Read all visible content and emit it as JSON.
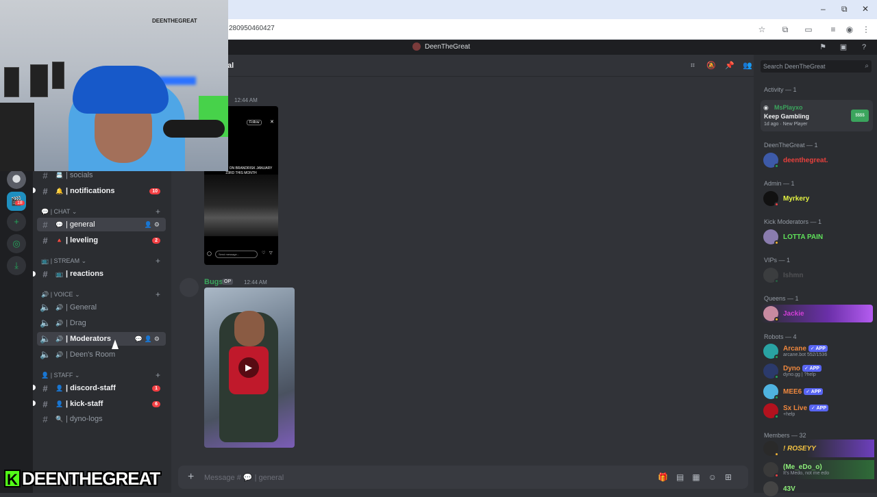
{
  "browser": {
    "url": "280950460427",
    "minimize": "–",
    "maximize": "⧉",
    "close": "✕"
  },
  "app": {
    "title": "DeenTheGreat",
    "channel_fragment": "al"
  },
  "channels": {
    "rows": [
      {
        "emoji": "📇",
        "label": "| socials",
        "badge": ""
      },
      {
        "emoji": "🔔",
        "label": "| notifications",
        "badge": "10"
      },
      {
        "emoji": "💬",
        "label": "| general",
        "badge": ""
      },
      {
        "emoji": "🔺",
        "label": "| leveling",
        "badge": "2"
      },
      {
        "emoji": "📺",
        "label": "| reactions",
        "badge": ""
      },
      {
        "emoji": "🔊",
        "label": "| General",
        "badge": ""
      },
      {
        "emoji": "🔊",
        "label": "| Drag",
        "badge": ""
      },
      {
        "emoji": "🔊",
        "label": "| Moderators",
        "badge": ""
      },
      {
        "emoji": "🔊",
        "label": "| Deen's Room",
        "badge": ""
      },
      {
        "emoji": "👤",
        "label": "| discord-staff",
        "badge": "1"
      },
      {
        "emoji": "👤",
        "label": "| kick-staff",
        "badge": "6"
      },
      {
        "emoji": "🔍",
        "label": "| dyno-logs",
        "badge": ""
      }
    ],
    "categories": {
      "chat": "| CHAT",
      "stream": "| STREAM",
      "voice": "| VOICE",
      "staff": "| STAFF"
    },
    "server_badge": "18"
  },
  "messages": {
    "first_time": "12:44 AM",
    "phone_caption": "AL. I FIGHT ON BRANDRISK JANUARY 23RD THIS MONTH",
    "phone_follow": "Follow",
    "phone_input": "Send message...",
    "second_author": "Bugs",
    "second_tag": "OP",
    "second_time": "12:44 AM"
  },
  "composer": {
    "placeholder": "Message # 💬 | general"
  },
  "brand": {
    "k": "K",
    "name": "DEENTHEGREAT"
  },
  "webcam": {
    "sign": "DEENTHEGREAT"
  },
  "members": {
    "search_placeholder": "Search DeenTheGreat",
    "activity_header": "Activity — 1",
    "activity_user": "MsPlayxo",
    "activity_title": "Keep Gambling",
    "activity_meta": "1d ago · New Player",
    "groups": {
      "owner": "DeenTheGreat — 1",
      "admin": "Admin — 1",
      "kickmods": "Kick Moderators — 1",
      "vips": "VIPs — 1",
      "queens": "Queens — 1",
      "robots": "Robots — 4",
      "members": "Members — 32"
    },
    "owner_name": "deenthegreat.",
    "admin_name": "Myrkery",
    "kickmod_name": "LOTTA PAIN",
    "vip_name": "Ishmn",
    "queen_name": "Jackie",
    "bots": [
      {
        "name": "Arcane",
        "sub": "arcane.bot 552/1536",
        "tag": "APP"
      },
      {
        "name": "Dyno",
        "sub": "dyno.gg | ?help",
        "tag": "APP"
      },
      {
        "name": "MEE6",
        "sub": "",
        "tag": "APP"
      },
      {
        "name": "Sx Live",
        "sub": "+help",
        "tag": "APP"
      }
    ],
    "member_1": "! ROSEYY",
    "member_2": "(Me_eDo_o)",
    "member_2_sub": "It's Medo, not me edo",
    "member_3": "43V"
  },
  "colors": {
    "owner": "#e8403c",
    "admin": "#e6f542",
    "kickmod": "#5fe15a",
    "queen": "#d13fd6",
    "bot": "#f0883e",
    "member_1": "#f5c442",
    "member_2": "#8ef07a"
  }
}
